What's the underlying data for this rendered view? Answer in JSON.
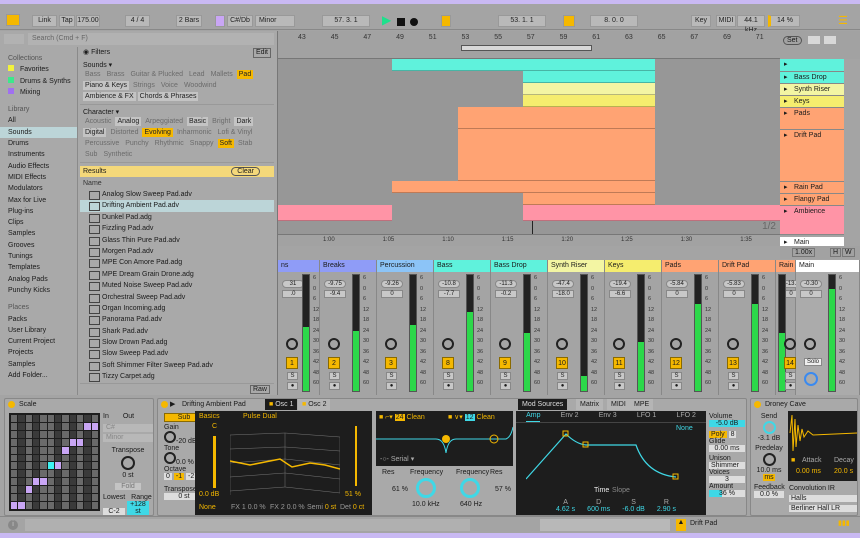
{
  "colors": {
    "accent": "#f5b800",
    "teal": "#5ff2dc",
    "selection": "#bcd5d8",
    "stripe": "#c9b9f3"
  },
  "toolbar": {
    "link": "Link",
    "tap": "Tap",
    "tempo": "175.00",
    "signature": "4 / 4",
    "quantize": "2 Bars",
    "key": "C#/Db",
    "scale": "Minor",
    "position": "57. 3. 1",
    "loop_start": "53. 1. 1",
    "loop_length": "8. 0. 0",
    "key_map": "Key",
    "midi_map": "MIDI",
    "sample_rate": "44.1 kHz",
    "cpu": "14 %"
  },
  "browser": {
    "search_placeholder": "Search (Cmd + F)",
    "collections_header": "Collections",
    "collections": [
      "Favorites",
      "Drums & Synths",
      "Mixing"
    ],
    "collection_colors": [
      "#f2f23c",
      "#3ce88c",
      "#a070f0"
    ],
    "library_header": "Library",
    "library": [
      "All",
      "Sounds",
      "Drums",
      "Instruments",
      "Audio Effects",
      "MIDI Effects",
      "Modulators",
      "Max for Live",
      "Plug-ins",
      "Clips",
      "Samples",
      "Grooves",
      "Tunings",
      "Templates",
      "Analog Pads",
      "Punchy Kicks"
    ],
    "library_selected": "Sounds",
    "places_header": "Places",
    "places": [
      "Packs",
      "User Library",
      "Current Project",
      "Projects",
      "Samples",
      "Add Folder..."
    ],
    "filters_label": "Filters",
    "edit_label": "Edit",
    "sounds_label": "Sounds ▾",
    "sounds_tags": [
      [
        "Bass",
        ""
      ],
      [
        "Brass",
        ""
      ],
      [
        "Guitar & Plucked",
        ""
      ],
      [
        "Lead",
        ""
      ],
      [
        "Mallets",
        ""
      ],
      [
        "Pad",
        "o"
      ],
      [
        "Piano & Keys",
        "b"
      ],
      [
        "Strings",
        ""
      ],
      [
        "Voice",
        ""
      ],
      [
        "Woodwind",
        ""
      ],
      [
        "Ambience & FX",
        "b"
      ],
      [
        "Chords & Phrases",
        "b"
      ]
    ],
    "character_label": "Character ▾",
    "character_tags": [
      [
        "Acoustic",
        ""
      ],
      [
        "Analog",
        "b"
      ],
      [
        "Arpeggiated",
        ""
      ],
      [
        "Basic",
        "b"
      ],
      [
        "Bright",
        ""
      ],
      [
        "Dark",
        "b"
      ],
      [
        "Digital",
        "b"
      ],
      [
        "Distorted",
        ""
      ],
      [
        "Evolving",
        "o"
      ],
      [
        "Inharmonic",
        ""
      ],
      [
        "Lofi & Vinyl",
        ""
      ],
      [
        "Percussive",
        ""
      ],
      [
        "Punchy",
        ""
      ],
      [
        "Rhythmic",
        ""
      ],
      [
        "Snappy",
        ""
      ],
      [
        "Soft",
        "o"
      ],
      [
        "Stab",
        ""
      ],
      [
        "Sub",
        ""
      ],
      [
        "Synthetic",
        ""
      ]
    ],
    "genres_label": "Genres ▸",
    "results_label": "Results",
    "clear_label": "Clear",
    "name_header": "Name",
    "raw_label": "Raw",
    "results": [
      "Analog Slow Sweep Pad.adv",
      "Drifting Ambient Pad.adv",
      "Dunkel Pad.adg",
      "Fizzling Pad.adv",
      "Glass Thin Pure Pad.adv",
      "Morgen Pad.adv",
      "MPE Con Amore Pad.adg",
      "MPE Dream Grain Drone.adg",
      "Muted Noise Sweep Pad.adv",
      "Orchestral Sweep Pad.adv",
      "Organ Incoming.adg",
      "Panorama Pad.adv",
      "Shark Pad.adv",
      "Slow Drown Pad.adg",
      "Slow Sweep Pad.adv",
      "Soft Shimmer Filter Sweep Pad.adv",
      "Tizzy Carpet.adg"
    ],
    "results_selected": "Drifting Ambient Pad.adv"
  },
  "arrangement": {
    "bars": [
      "43",
      "45",
      "47",
      "49",
      "51",
      "53",
      "55",
      "57",
      "59",
      "61",
      "63",
      "65",
      "67",
      "69",
      "71"
    ],
    "set_label": "Set",
    "page": "1/2",
    "time_ticks": [
      "1:00",
      "1:05",
      "1:10",
      "1:15",
      "1:20",
      "1:25",
      "1:30",
      "1:35"
    ],
    "zoom": "1.00x",
    "h_label": "H",
    "w_label": "W",
    "tracks": [
      {
        "name": "",
        "color": "#5ff2dc"
      },
      {
        "name": "Bass Drop",
        "color": "#5ff2dc"
      },
      {
        "name": "Synth Riser",
        "color": "#f3f5a3"
      },
      {
        "name": "Keys",
        "color": "#f5ed6e"
      },
      {
        "name": "Pads",
        "color": "#ffa373"
      },
      {
        "name": "Drift Pad",
        "color": "#ffa373"
      },
      {
        "name": "Rain Pad",
        "color": "#ffa373"
      },
      {
        "name": "Flangy Pad",
        "color": "#ffa373"
      },
      {
        "name": "Ambience",
        "color": "#ff94a6"
      },
      {
        "name": "Main",
        "color": "#ffffff"
      }
    ]
  },
  "mixer": {
    "channels": [
      {
        "name": "ns",
        "color": "#8f9cf7",
        "peak": "31",
        "volume": ".0",
        "number": "1",
        "level": 0.55
      },
      {
        "name": "Breaks",
        "color": "#8f9cf7",
        "peak": "-9.75",
        "volume": "-9.4",
        "number": "2",
        "level": 0.52
      },
      {
        "name": "Percussion",
        "color": "#8cc4f7",
        "peak": "-9.26",
        "volume": "0",
        "number": "3",
        "level": 0.57
      },
      {
        "name": "Bass",
        "color": "#5ff2dc",
        "peak": "-10.8",
        "volume": "-7.7",
        "number": "8",
        "level": 0.68
      },
      {
        "name": "Bass Drop",
        "color": "#5ff2dc",
        "peak": "-11.3",
        "volume": "-0.2",
        "number": "9",
        "level": 0.5
      },
      {
        "name": "Synth Riser",
        "color": "#f3f5a3",
        "peak": "-47.4",
        "volume": "-18.0",
        "number": "10",
        "level": 0.13
      },
      {
        "name": "Keys",
        "color": "#f5ed6e",
        "peak": "-19.4",
        "volume": "-6.6",
        "number": "11",
        "level": 0.42
      },
      {
        "name": "Pads",
        "color": "#ffa373",
        "peak": "-5.84",
        "volume": "0",
        "number": "12",
        "level": 0.75
      },
      {
        "name": "Drift Pad",
        "color": "#ffa373",
        "peak": "-5.83",
        "volume": "0",
        "number": "13",
        "level": 0.75
      },
      {
        "name": "Rain P",
        "color": "#ffa373",
        "peak": "-13.",
        "volume": "0",
        "number": "14",
        "level": 0.5
      },
      {
        "name": "Main",
        "color": "#ffffff",
        "peak": "-0.30",
        "volume": "0",
        "number": "Solo",
        "level": 0.88
      }
    ],
    "scale_labels": [
      "6",
      "0",
      "6",
      "12",
      "18",
      "24",
      "30",
      "36",
      "42",
      "48",
      "60"
    ],
    "solo_label": "S"
  },
  "devices": {
    "scale": {
      "title": "Scale",
      "in": "In",
      "out": "Out",
      "base": "C#",
      "mode": "Minor",
      "transpose_label": "Transpose",
      "transpose": "0 st",
      "fold": "Fold",
      "lowest_label": "Lowest",
      "range_label": "Range",
      "lowest": "C-2",
      "range": "+128 st"
    },
    "drift": {
      "title": "Drifting Ambient Pad",
      "osc1": "Osc 1",
      "osc2": "Osc 2",
      "sub": "Sub",
      "gain_label": "Gain",
      "gain": "-20 dB",
      "tone_label": "Tone",
      "tone": "0.0 %",
      "octave_label": "Octave",
      "octaves": [
        "0",
        "-1",
        "-2"
      ],
      "transpose_label": "Transpose",
      "transpose": "0 st",
      "wavetable_cat": "Basics",
      "wavetable": "Pulse Dual",
      "note": "C",
      "osc_gain": "0.0 dB",
      "position": "51 %",
      "fx_mode": "None",
      "fx1": "FX 1 0.0 %",
      "fx2": "FX 2 0.0 %",
      "semi_label": "Semi",
      "semi": "0 st",
      "det_label": "Det",
      "det": "0 ct",
      "filter1_slope": "24",
      "filter1_type": "Clean",
      "filter2_slope": "12",
      "filter2_type": "Clean",
      "routing": "Serial",
      "res1_label": "Res",
      "res1": "61 %",
      "freq1_label": "Frequency",
      "freq1": "10.0 kHz",
      "freq2_label": "Frequency",
      "freq2": "640 Hz",
      "res2_label": "Res",
      "res2": "57 %",
      "mod_tabs": [
        "Mod Sources",
        "Matrix",
        "MIDI",
        "MPE"
      ],
      "env_tabs": [
        "Amp",
        "Env 2",
        "Env 3",
        "LFO 1",
        "LFO 2"
      ],
      "env_dest": "None",
      "time_label": "Time",
      "slope_label": "Slope",
      "adsr_labels": [
        "A",
        "D",
        "S",
        "R"
      ],
      "adsr": [
        "4.62 s",
        "600 ms",
        "-6.0 dB",
        "2.90 s"
      ],
      "volume_label": "Volume",
      "volume": "-5.0 dB",
      "poly": "Poly",
      "voices_num": "8",
      "glide_label": "Glide",
      "glide": "0.00 ms",
      "unison_label": "Unison",
      "unison": "Shimmer",
      "voices_label": "Voices",
      "voices": "3",
      "amount_label": "Amount",
      "amount": "36 %"
    },
    "reverb": {
      "title": "Droney Cave",
      "send_label": "Send",
      "send": "-3.1 dB",
      "predelay_label": "Predelay",
      "predelay": "10.0 ms",
      "ms": "ms",
      "feedback_label": "Feedback",
      "feedback": "0.0 %",
      "attack_label": "Attack",
      "attack": "0.00 ms",
      "decay_label": "Decay",
      "decay": "20.0 s",
      "ir_label": "Convolution IR",
      "ir_category": "Halls",
      "ir_file": "Berliner Hall LR"
    }
  },
  "status": {
    "track": "Drift Pad"
  }
}
